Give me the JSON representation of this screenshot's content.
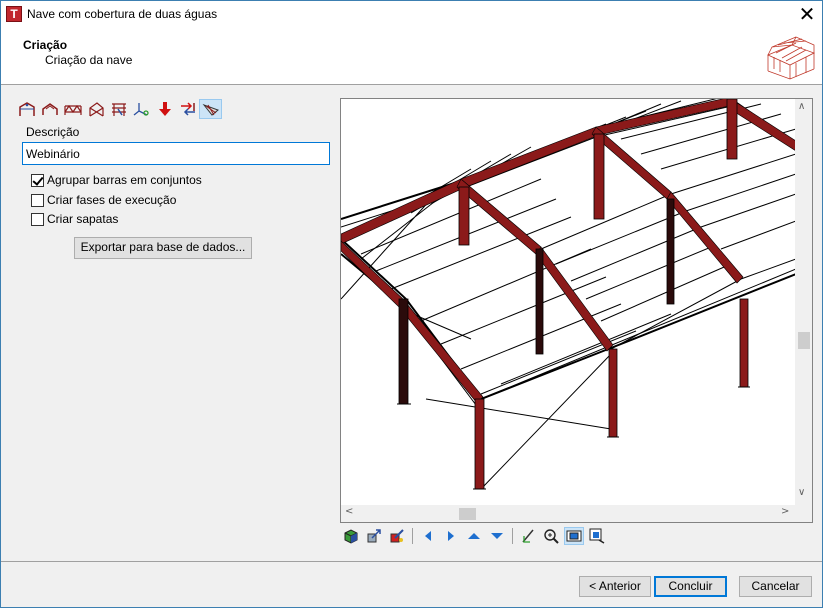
{
  "window": {
    "title": "Nave com cobertura de duas águas",
    "close_glyph": "✕"
  },
  "header": {
    "title": "Criação",
    "subtitle": "Criação da nave",
    "logo_icon": "wireframe-roof-icon"
  },
  "toolbar": {
    "icons": [
      "portal-frame-icon",
      "gable-frame-icon",
      "truss-icon",
      "bracing-icon",
      "purlin-icon",
      "axis-icon",
      "load-arrow-icon",
      "transfer-icon",
      "roof-wizard-icon"
    ]
  },
  "form": {
    "description_label": "Descrição",
    "description_value": "Webinário",
    "check_group_bars": {
      "label": "Agrupar barras em conjuntos",
      "checked": true
    },
    "check_phases": {
      "label": "Criar fases de execução",
      "checked": false
    },
    "check_footings": {
      "label": "Criar sapatas",
      "checked": false
    },
    "export_button": "Exportar para base de dados..."
  },
  "viewport": {
    "scroll_up": "∧",
    "scroll_down": "∨",
    "scroll_left": "<",
    "scroll_right": ">",
    "frame_color": "#8b1a1a"
  },
  "view_tools": [
    "render-3d-icon",
    "move-view-icon",
    "color-render-icon",
    "pan-left-icon",
    "pan-right-icon",
    "pan-up-icon",
    "pan-down-icon",
    "edit-view-icon",
    "zoom-icon",
    "zoom-window-icon",
    "zoom-all-icon"
  ],
  "footer": {
    "back_button": "< Anterior",
    "finish_button": "Concluir",
    "cancel_button": "Cancelar"
  },
  "colors": {
    "accent": "#0078d7",
    "frame": "#8b1a1a"
  }
}
